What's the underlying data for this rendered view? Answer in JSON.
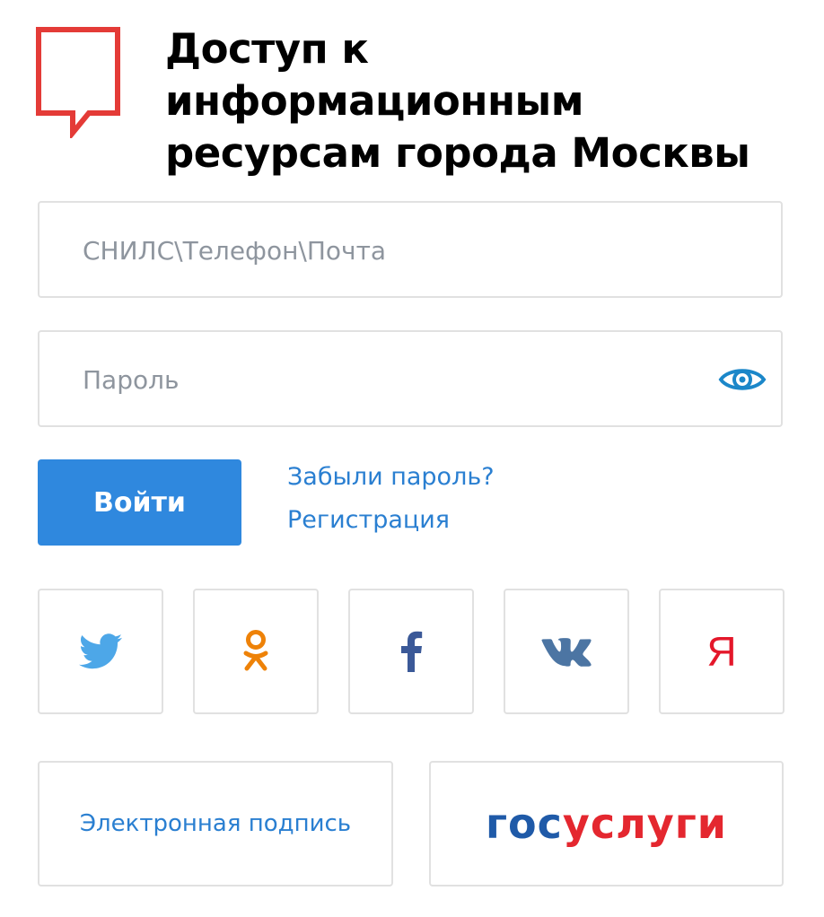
{
  "header": {
    "title_line1": "Доступ к информационным",
    "title_line2": "ресурсам города Москвы",
    "logo_icon": "mos-speech-bubble-logo",
    "logo_color": "#e43b37"
  },
  "form": {
    "login_placeholder": "СНИЛС\\Телефон\\Почта",
    "login_value": "",
    "password_placeholder": "Пароль",
    "password_value": "",
    "show_password_icon": "eye-icon",
    "submit_label": "Войти"
  },
  "links": {
    "forgot_password": "Забыли пароль?",
    "register": "Регистрация"
  },
  "social": [
    {
      "name": "twitter",
      "icon": "twitter-icon",
      "color": "#4da7e8"
    },
    {
      "name": "odnoklassniki",
      "icon": "odnoklassniki-icon",
      "color": "#ee8208"
    },
    {
      "name": "facebook",
      "icon": "facebook-icon",
      "color": "#3b5998"
    },
    {
      "name": "vkontakte",
      "icon": "vk-icon",
      "color": "#4c75a3"
    },
    {
      "name": "yandex",
      "icon": "yandex-icon",
      "color": "#e4172a",
      "glyph": "Я"
    }
  ],
  "alternatives": {
    "electronic_signature": "Электронная подпись",
    "gosuslugi_part1": "гос",
    "gosuslugi_part2": "услуги"
  },
  "colors": {
    "accent": "#2f88de",
    "link": "#2a7fd1",
    "border": "#e1e1e1",
    "placeholder": "#8e959e"
  }
}
